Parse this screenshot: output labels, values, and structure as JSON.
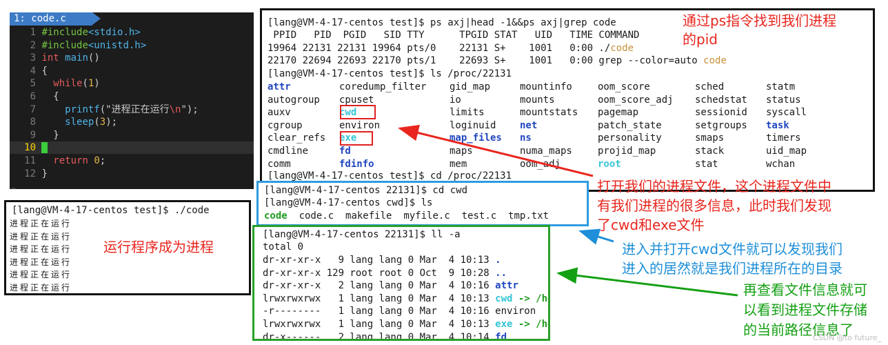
{
  "editor": {
    "tab_label": "1: code.c",
    "lines": [
      {
        "num": "1",
        "parts": [
          {
            "t": "#include",
            "c": "pp"
          },
          {
            "t": "<stdio.h>",
            "c": "fn"
          }
        ]
      },
      {
        "num": "2",
        "parts": [
          {
            "t": "#include",
            "c": "pp"
          },
          {
            "t": "<unistd.h>",
            "c": "fn"
          }
        ]
      },
      {
        "num": "3",
        "parts": [
          {
            "t": "int",
            "c": "kw"
          },
          {
            "t": " ",
            "c": ""
          },
          {
            "t": "main",
            "c": "fn"
          },
          {
            "t": "()",
            "c": ""
          }
        ]
      },
      {
        "num": "4",
        "parts": [
          {
            "t": "{",
            "c": ""
          }
        ]
      },
      {
        "num": "5",
        "parts": [
          {
            "t": "  ",
            "c": ""
          },
          {
            "t": "while",
            "c": "kw"
          },
          {
            "t": "(",
            "c": ""
          },
          {
            "t": "1",
            "c": "num"
          },
          {
            "t": ")",
            "c": ""
          }
        ]
      },
      {
        "num": "6",
        "parts": [
          {
            "t": "  {",
            "c": ""
          }
        ]
      },
      {
        "num": "7",
        "parts": [
          {
            "t": "    ",
            "c": ""
          },
          {
            "t": "printf",
            "c": "fn"
          },
          {
            "t": "(\"",
            "c": ""
          },
          {
            "t": "进程正在运行",
            "c": "str"
          },
          {
            "t": "\\n",
            "c": "kw"
          },
          {
            "t": "\");",
            "c": ""
          }
        ]
      },
      {
        "num": "8",
        "parts": [
          {
            "t": "    ",
            "c": ""
          },
          {
            "t": "sleep",
            "c": "fn"
          },
          {
            "t": "(",
            "c": ""
          },
          {
            "t": "3",
            "c": "num"
          },
          {
            "t": ");",
            "c": ""
          }
        ]
      },
      {
        "num": "9",
        "parts": [
          {
            "t": "  }",
            "c": ""
          }
        ]
      },
      {
        "num": "10",
        "parts": [
          {
            "t": "",
            "c": "cursor"
          }
        ],
        "current": true
      },
      {
        "num": "11",
        "parts": [
          {
            "t": "  ",
            "c": ""
          },
          {
            "t": "return",
            "c": "kw"
          },
          {
            "t": " ",
            "c": ""
          },
          {
            "t": "0",
            "c": "num"
          },
          {
            "t": ";",
            "c": ""
          }
        ]
      },
      {
        "num": "12",
        "parts": [
          {
            "t": "}",
            "c": ""
          }
        ]
      }
    ],
    "tilde": "~"
  },
  "run_terminal": {
    "prompt": "[lang@VM-4-17-centos test]$ ./code",
    "output": [
      "进程正在运行",
      "进程正在运行",
      "进程正在运行",
      "进程正在运行",
      "进程正在运行",
      "进程正在运行"
    ]
  },
  "proc_terminal": {
    "cmd1": "[lang@VM-4-17-centos test]$ ps axj|head -1&&ps axj|grep code",
    "ps_header": " PPID   PID  PGID   SID TTY      TPGID STAT   UID   TIME COMMAND",
    "ps_row1_pre": "19964 22131 22131 19964 pts/0    22131 S+    1001   0:00 ./",
    "ps_row1_hl": "code",
    "ps_row2_pre": "22170 22694 22693 22170 pts/1    22693 S+    1001   0:00 grep --color=auto ",
    "ps_row2_hl": "code",
    "cmd2": "[lang@VM-4-17-centos test]$ ls /proc/22131",
    "ls_rows": [
      [
        {
          "t": "attr",
          "c": "bl"
        },
        {
          "t": "coredump_filter",
          "c": ""
        },
        {
          "t": "gid_map",
          "c": ""
        },
        {
          "t": "mountinfo",
          "c": ""
        },
        {
          "t": "oom_score",
          "c": ""
        },
        {
          "t": "sched",
          "c": ""
        },
        {
          "t": "statm",
          "c": ""
        }
      ],
      [
        {
          "t": "autogroup",
          "c": ""
        },
        {
          "t": "cpuset",
          "c": ""
        },
        {
          "t": "io",
          "c": ""
        },
        {
          "t": "mounts",
          "c": ""
        },
        {
          "t": "oom_score_adj",
          "c": ""
        },
        {
          "t": "schedstat",
          "c": ""
        },
        {
          "t": "status",
          "c": ""
        }
      ],
      [
        {
          "t": "auxv",
          "c": ""
        },
        {
          "t": "cwd",
          "c": "cy"
        },
        {
          "t": "limits",
          "c": ""
        },
        {
          "t": "mountstats",
          "c": ""
        },
        {
          "t": "pagemap",
          "c": ""
        },
        {
          "t": "sessionid",
          "c": ""
        },
        {
          "t": "syscall",
          "c": ""
        }
      ],
      [
        {
          "t": "cgroup",
          "c": ""
        },
        {
          "t": "environ",
          "c": ""
        },
        {
          "t": "loginuid",
          "c": ""
        },
        {
          "t": "net",
          "c": "bl"
        },
        {
          "t": "patch_state",
          "c": ""
        },
        {
          "t": "setgroups",
          "c": ""
        },
        {
          "t": "task",
          "c": "bl"
        }
      ],
      [
        {
          "t": "clear_refs",
          "c": ""
        },
        {
          "t": "exe",
          "c": "cy"
        },
        {
          "t": "map_files",
          "c": "bl"
        },
        {
          "t": "ns",
          "c": "bl"
        },
        {
          "t": "personality",
          "c": ""
        },
        {
          "t": "smaps",
          "c": ""
        },
        {
          "t": "timers",
          "c": ""
        }
      ],
      [
        {
          "t": "cmdline",
          "c": ""
        },
        {
          "t": "fd",
          "c": "bl"
        },
        {
          "t": "maps",
          "c": ""
        },
        {
          "t": "numa_maps",
          "c": ""
        },
        {
          "t": "projid_map",
          "c": ""
        },
        {
          "t": "stack",
          "c": ""
        },
        {
          "t": "uid_map",
          "c": ""
        }
      ],
      [
        {
          "t": "comm",
          "c": ""
        },
        {
          "t": "fdinfo",
          "c": "bl"
        },
        {
          "t": "mem",
          "c": ""
        },
        {
          "t": "oom_adj",
          "c": ""
        },
        {
          "t": "root",
          "c": "cy"
        },
        {
          "t": "stat",
          "c": ""
        },
        {
          "t": "wchan",
          "c": ""
        }
      ]
    ],
    "cmd3": "[lang@VM-4-17-centos test]$ cd /proc/22131"
  },
  "cwd_terminal": {
    "cmd1": "[lang@VM-4-17-centos 22131]$ cd cwd",
    "cmd2": "[lang@VM-4-17-centos cwd]$ ls",
    "files": [
      {
        "t": "code",
        "c": "gr"
      },
      {
        "t": "code.c",
        "c": ""
      },
      {
        "t": "makefile",
        "c": ""
      },
      {
        "t": "myfile.c",
        "c": ""
      },
      {
        "t": "test.c",
        "c": ""
      },
      {
        "t": "tmp.txt",
        "c": ""
      }
    ]
  },
  "ll_terminal": {
    "cmd": "[lang@VM-4-17-centos 22131]$ ll -a",
    "total": "total 0",
    "rows": [
      {
        "meta": "dr-xr-xr-x   9 lang lang 0 Mar  4 10:13 ",
        "name": ".",
        "c": "bl",
        "rest": ""
      },
      {
        "meta": "dr-xr-xr-x 129 root root 0 Oct  9 10:28 ",
        "name": "..",
        "c": "bl",
        "rest": ""
      },
      {
        "meta": "dr-xr-xr-x   2 lang lang 0 Mar  4 10:16 ",
        "name": "attr",
        "c": "bl",
        "rest": ""
      },
      {
        "meta": "lrwxrwxrwx   1 lang lang 0 Mar  4 10:13 ",
        "name": "cwd",
        "c": "cy",
        "rest": " -> /home/lang/myfile/test"
      },
      {
        "meta": "-r--------   1 lang lang 0 Mar  4 10:16 ",
        "name": "environ",
        "c": "",
        "rest": ""
      },
      {
        "meta": "lrwxrwxrwx   1 lang lang 0 Mar  4 10:13 ",
        "name": "exe",
        "c": "cy",
        "rest": " -> /home/lang/myfile/test/code"
      },
      {
        "meta": "dr-x------   2 lang lang 0 Mar  4 10:14 ",
        "name": "fd",
        "c": "bl",
        "rest": ""
      }
    ]
  },
  "annotations": {
    "find_pid": "通过ps指令找到我们进程\n的pid",
    "run_program": "运行程序成为进程",
    "open_proc": "打开我们的进程文件，这个进程文件中\n有我们进程的很多信息，此时我们发现\n了cwd和exe文件",
    "enter_cwd": "进入并打开cwd文件就可以发现我们\n进入的居然就是我们进程所在的目录",
    "file_info": "再查看文件信息就可\n以看到进程文件存储\n的当前路径信息了"
  },
  "watermark": "CSDN @to future_",
  "colors": {
    "annotation_red": "#e8261e",
    "annotation_blue": "#1e8fd8",
    "annotation_green": "#14a014",
    "vim_tab": "#3d7bc6",
    "cwd_box_border": "#2f9be0",
    "ll_box_border": "#2aa02a"
  }
}
